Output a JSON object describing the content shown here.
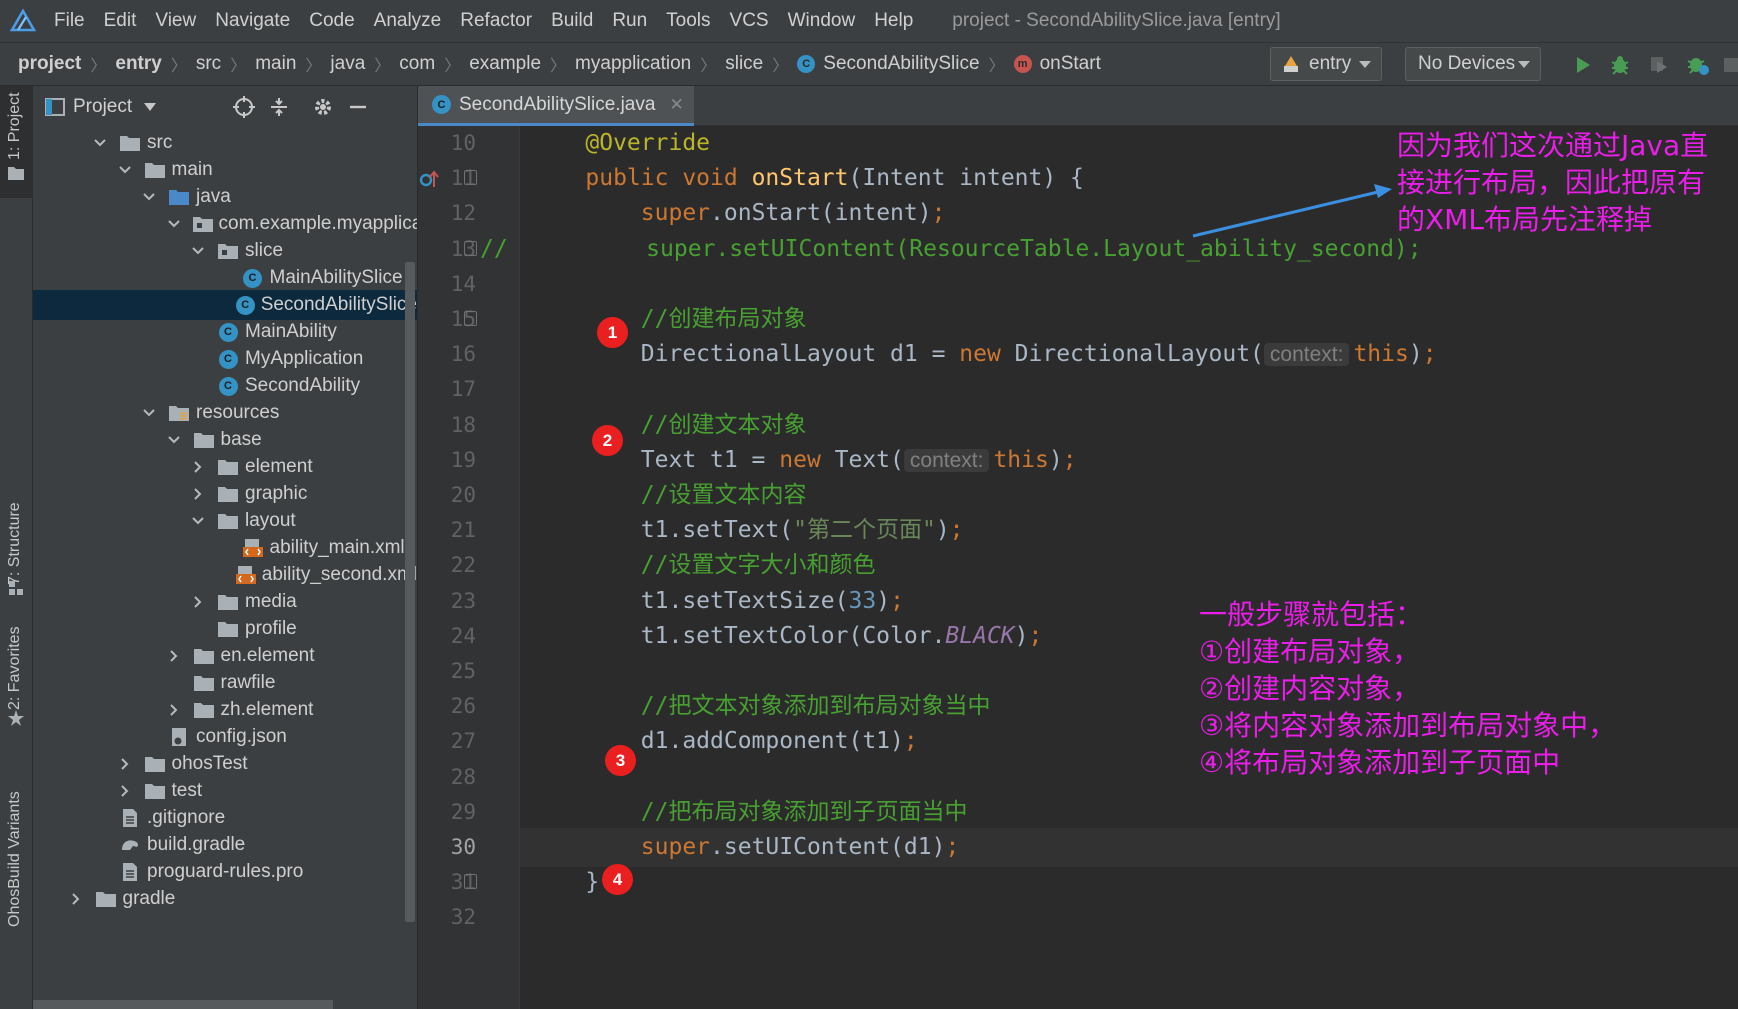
{
  "menubar": {
    "items": [
      "File",
      "Edit",
      "View",
      "Navigate",
      "Code",
      "Analyze",
      "Refactor",
      "Build",
      "Run",
      "Tools",
      "VCS",
      "Window",
      "Help"
    ],
    "window_title": "project - SecondAbilitySlice.java [entry]"
  },
  "breadcrumb": {
    "items": [
      "project",
      "entry",
      "src",
      "main",
      "java",
      "com",
      "example",
      "myapplication",
      "slice",
      "SecondAbilitySlice",
      "onStart"
    ]
  },
  "toolbar": {
    "run_config": "entry",
    "device": "No Devices",
    "icons": [
      "run-icon",
      "debug-icon",
      "attach-debugger-icon",
      "profile-icon",
      "stop-icon"
    ]
  },
  "left_strip": {
    "labels": [
      "1: Project",
      "7: Structure",
      "2: Favorites",
      "OhosBuild Variants"
    ]
  },
  "project_panel": {
    "title": "Project",
    "tree": [
      {
        "label": "src",
        "type": "folder",
        "depth": 0,
        "expanded": true
      },
      {
        "label": "main",
        "type": "folder",
        "depth": 1,
        "expanded": true
      },
      {
        "label": "java",
        "type": "folder-src",
        "depth": 2,
        "expanded": true
      },
      {
        "label": "com.example.myapplication",
        "type": "package",
        "depth": 3,
        "expanded": true
      },
      {
        "label": "slice",
        "type": "package",
        "depth": 4,
        "expanded": true
      },
      {
        "label": "MainAbilitySlice",
        "type": "class",
        "depth": 5
      },
      {
        "label": "SecondAbilitySlice",
        "type": "class",
        "depth": 5,
        "selected": true
      },
      {
        "label": "MainAbility",
        "type": "class",
        "depth": 4
      },
      {
        "label": "MyApplication",
        "type": "class",
        "depth": 4
      },
      {
        "label": "SecondAbility",
        "type": "class",
        "depth": 4
      },
      {
        "label": "resources",
        "type": "folder-res",
        "depth": 2,
        "expanded": true
      },
      {
        "label": "base",
        "type": "folder",
        "depth": 3,
        "expanded": true
      },
      {
        "label": "element",
        "type": "folder",
        "depth": 4,
        "expanded": false
      },
      {
        "label": "graphic",
        "type": "folder",
        "depth": 4,
        "expanded": false
      },
      {
        "label": "layout",
        "type": "folder",
        "depth": 4,
        "expanded": true
      },
      {
        "label": "ability_main.xml",
        "type": "xml",
        "depth": 5
      },
      {
        "label": "ability_second.xml",
        "type": "xml",
        "depth": 5
      },
      {
        "label": "media",
        "type": "folder",
        "depth": 4,
        "expanded": false
      },
      {
        "label": "profile",
        "type": "folder",
        "depth": 4
      },
      {
        "label": "en.element",
        "type": "folder",
        "depth": 3,
        "expanded": false
      },
      {
        "label": "rawfile",
        "type": "folder",
        "depth": 3
      },
      {
        "label": "zh.element",
        "type": "folder",
        "depth": 3,
        "expanded": false
      },
      {
        "label": "config.json",
        "type": "json",
        "depth": 2
      },
      {
        "label": "ohosTest",
        "type": "folder",
        "depth": 1,
        "expanded": false
      },
      {
        "label": "test",
        "type": "folder",
        "depth": 1,
        "expanded": false
      },
      {
        "label": ".gitignore",
        "type": "file",
        "depth": 0
      },
      {
        "label": "build.gradle",
        "type": "gradle",
        "depth": 0
      },
      {
        "label": "proguard-rules.pro",
        "type": "file",
        "depth": 0
      },
      {
        "label": "gradle",
        "type": "folder",
        "depth": -1,
        "expanded": false
      }
    ]
  },
  "editor": {
    "tab_label": "SecondAbilitySlice.java",
    "line_numbers": [
      "10",
      "11",
      "12",
      "13",
      "14",
      "15",
      "16",
      "17",
      "18",
      "19",
      "20",
      "21",
      "22",
      "23",
      "24",
      "25",
      "26",
      "27",
      "28",
      "29",
      "30",
      "31",
      "32"
    ],
    "current_line": "30",
    "code": [
      [
        {
          "t": "    ",
          "c": ""
        },
        {
          "t": "@Override",
          "c": "ann"
        }
      ],
      [
        {
          "t": "    ",
          "c": ""
        },
        {
          "t": "public void ",
          "c": "kw"
        },
        {
          "t": "onStart",
          "c": "fn"
        },
        {
          "t": "(Intent intent) {",
          "c": ""
        }
      ],
      [
        {
          "t": "        ",
          "c": ""
        },
        {
          "t": "super",
          "c": "kw"
        },
        {
          "t": ".onStart(intent)",
          "c": ""
        },
        {
          "t": ";",
          "c": "kw"
        }
      ],
      [
        {
          "t": "//",
          "c": "cm"
        },
        {
          "t": "          super.setUIContent(ResourceTable.Layout_ability_second);",
          "c": "cm"
        }
      ],
      [],
      [
        {
          "t": "        ",
          "c": ""
        },
        {
          "t": "//创建布局对象",
          "c": "cm"
        }
      ],
      [
        {
          "t": "        DirectionalLayout d1 = ",
          "c": ""
        },
        {
          "t": "new ",
          "c": "kw"
        },
        {
          "t": "DirectionalLayout(",
          "c": ""
        },
        {
          "t": "context:",
          "c": "hint"
        },
        {
          "t": "this",
          "c": "kw"
        },
        {
          "t": ")",
          "c": ""
        },
        {
          "t": ";",
          "c": "kw"
        }
      ],
      [],
      [
        {
          "t": "        ",
          "c": ""
        },
        {
          "t": "//创建文本对象",
          "c": "cm"
        }
      ],
      [
        {
          "t": "        Text t1 = ",
          "c": ""
        },
        {
          "t": "new ",
          "c": "kw"
        },
        {
          "t": "Text(",
          "c": ""
        },
        {
          "t": "context:",
          "c": "hint"
        },
        {
          "t": "this",
          "c": "kw"
        },
        {
          "t": ")",
          "c": ""
        },
        {
          "t": ";",
          "c": "kw"
        }
      ],
      [
        {
          "t": "        ",
          "c": ""
        },
        {
          "t": "//设置文本内容",
          "c": "cm"
        }
      ],
      [
        {
          "t": "        t1.setText(",
          "c": ""
        },
        {
          "t": "\"第二个页面\"",
          "c": "str"
        },
        {
          "t": ")",
          "c": ""
        },
        {
          "t": ";",
          "c": "kw"
        }
      ],
      [
        {
          "t": "        ",
          "c": ""
        },
        {
          "t": "//设置文字大小和颜色",
          "c": "cm"
        }
      ],
      [
        {
          "t": "        t1.setTextSize(",
          "c": ""
        },
        {
          "t": "33",
          "c": "num"
        },
        {
          "t": ")",
          "c": ""
        },
        {
          "t": ";",
          "c": "kw"
        }
      ],
      [
        {
          "t": "        t1.setTextColor(Color.",
          "c": ""
        },
        {
          "t": "BLACK",
          "c": "static"
        },
        {
          "t": ")",
          "c": ""
        },
        {
          "t": ";",
          "c": "kw"
        }
      ],
      [],
      [
        {
          "t": "        ",
          "c": ""
        },
        {
          "t": "//把文本对象添加到布局对象当中",
          "c": "cm"
        }
      ],
      [
        {
          "t": "        d1.addComponent(t1)",
          "c": ""
        },
        {
          "t": ";",
          "c": "kw"
        }
      ],
      [],
      [
        {
          "t": "        ",
          "c": ""
        },
        {
          "t": "//把布局对象添加到子页面当中",
          "c": "cm"
        }
      ],
      [
        {
          "t": "        ",
          "c": ""
        },
        {
          "t": "super",
          "c": "kw"
        },
        {
          "t": ".setUIContent(d1)",
          "c": ""
        },
        {
          "t": ";",
          "c": "kw"
        }
      ],
      [
        {
          "t": "    }",
          "c": ""
        }
      ],
      []
    ]
  },
  "annotations": {
    "badges": [
      "1",
      "2",
      "3",
      "4"
    ],
    "top_note": [
      "因为我们这次通过Java直",
      "接进行布局，因此把原有",
      "的XML布局先注释掉"
    ],
    "steps_note": [
      "一般步骤就包括：",
      "①创建布局对象，",
      "②创建内容对象，",
      "③将内容对象添加到布局对象中，",
      "④将布局对象添加到子页面中"
    ],
    "note_color": "#e91ee8",
    "badge_color": "#ea1f1f",
    "arrow_color": "#3b8fe0"
  }
}
